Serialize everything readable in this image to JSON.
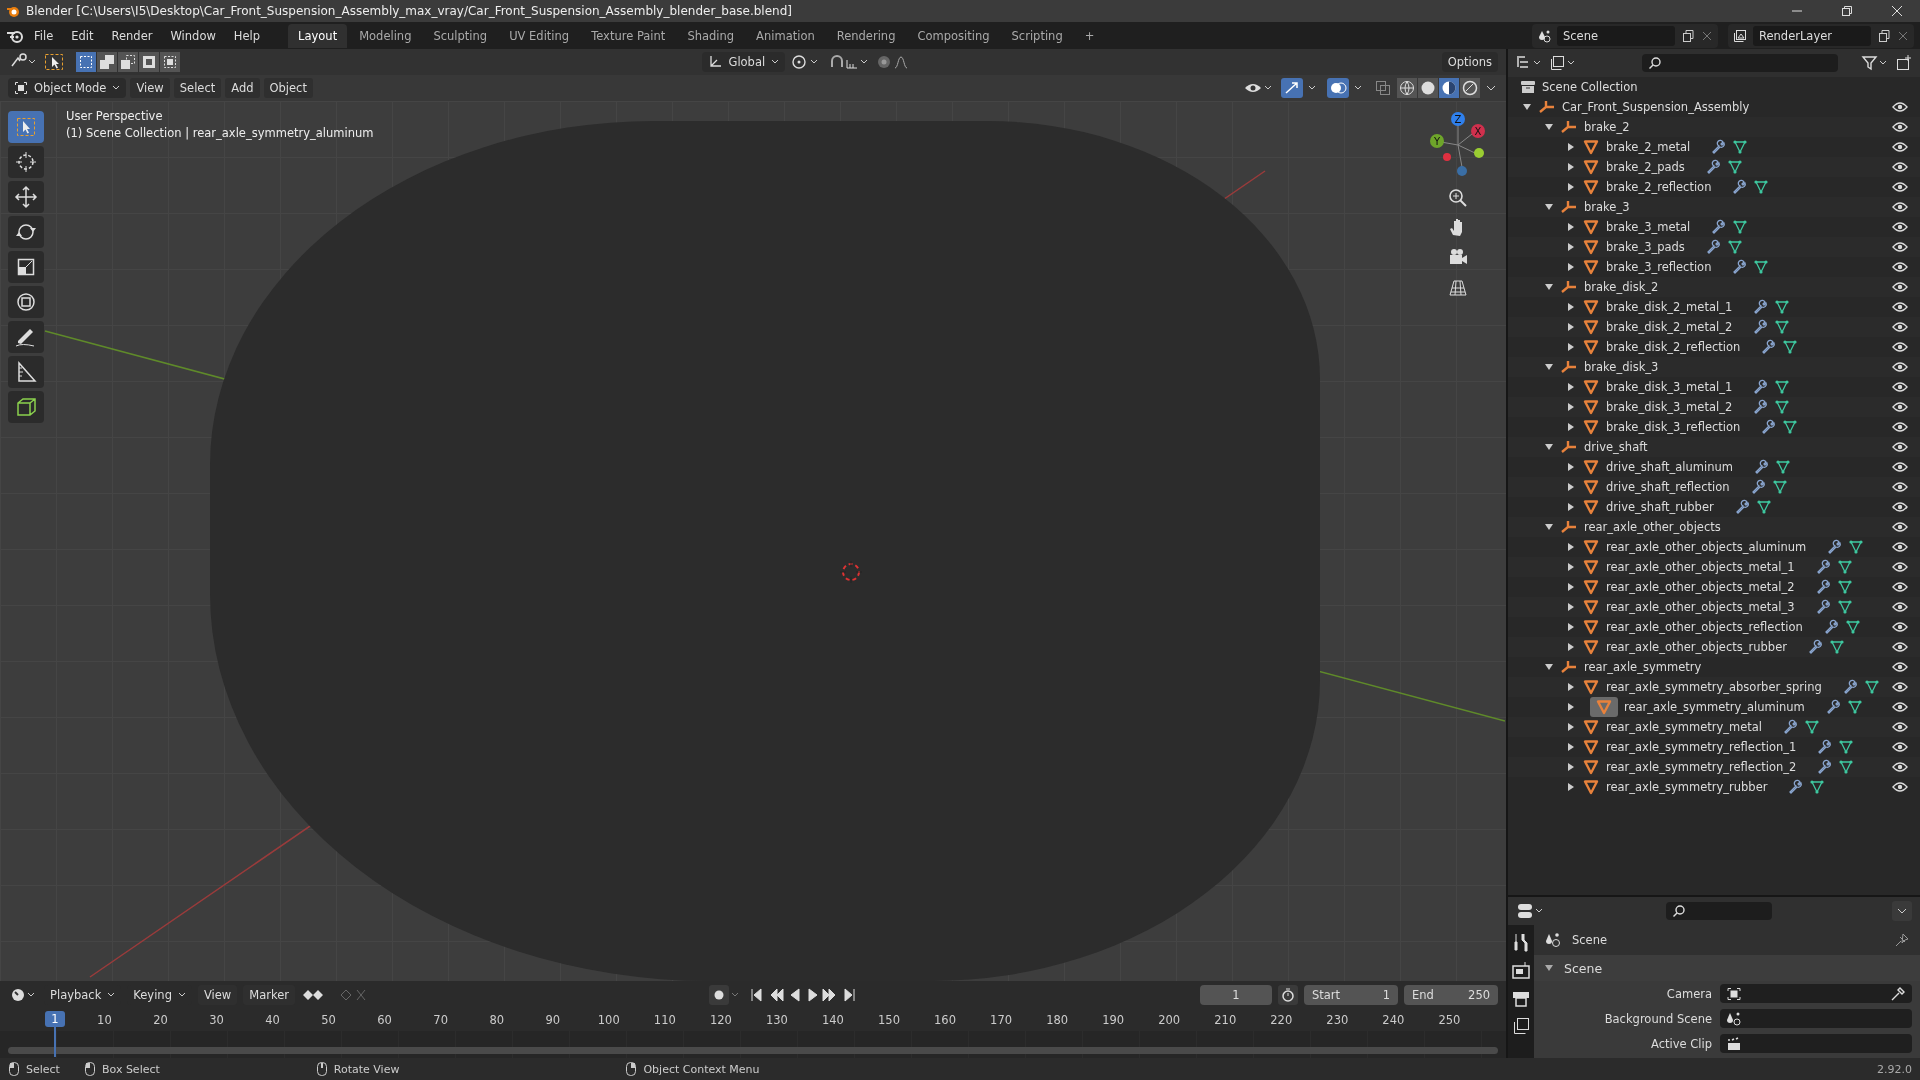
{
  "window": {
    "title": "Blender [C:\\Users\\I5\\Desktop\\Car_Front_Suspension_Assembly_max_vray/Car_Front_Suspension_Assembly_blender_base.blend]"
  },
  "menu": [
    "File",
    "Edit",
    "Render",
    "Window",
    "Help"
  ],
  "workspaces": [
    {
      "label": "Layout",
      "selected": true
    },
    {
      "label": "Modeling",
      "selected": false
    },
    {
      "label": "Sculpting",
      "selected": false
    },
    {
      "label": "UV Editing",
      "selected": false
    },
    {
      "label": "Texture Paint",
      "selected": false
    },
    {
      "label": "Shading",
      "selected": false
    },
    {
      "label": "Animation",
      "selected": false
    },
    {
      "label": "Rendering",
      "selected": false
    },
    {
      "label": "Compositing",
      "selected": false
    },
    {
      "label": "Scripting",
      "selected": false
    }
  ],
  "add_workspace": "+",
  "scene_field": "Scene",
  "view_layer_field": "RenderLayer",
  "viewport": {
    "orientation": "Global",
    "options": "Options",
    "mode": "Object Mode",
    "menus": [
      "View",
      "Select",
      "Add",
      "Object"
    ],
    "overlay_lines": [
      "User Perspective",
      "(1) Scene Collection | rear_axle_symmetry_aluminum"
    ],
    "shading_modes": [
      {
        "kind": "wireframe",
        "selected": false
      },
      {
        "kind": "solid",
        "selected": false
      },
      {
        "kind": "material",
        "selected": true
      },
      {
        "kind": "rendered",
        "selected": false
      }
    ],
    "gizmo_axes": [
      "Z",
      "Y",
      "X"
    ]
  },
  "outliner": {
    "root": "Scene Collection",
    "tree": [
      {
        "name": "Car_Front_Suspension_Assembly",
        "kind": "collection",
        "expanded": true,
        "selected": false,
        "children": [
          {
            "name": "brake_2",
            "kind": "collection",
            "expanded": true,
            "selected": false,
            "children": [
              {
                "name": "brake_2_metal",
                "kind": "mesh",
                "expanded": false,
                "selected": false
              },
              {
                "name": "brake_2_pads",
                "kind": "mesh",
                "expanded": false,
                "selected": false
              },
              {
                "name": "brake_2_reflection",
                "kind": "mesh",
                "expanded": false,
                "selected": false
              }
            ]
          },
          {
            "name": "brake_3",
            "kind": "collection",
            "expanded": true,
            "selected": false,
            "children": [
              {
                "name": "brake_3_metal",
                "kind": "mesh",
                "expanded": false,
                "selected": false
              },
              {
                "name": "brake_3_pads",
                "kind": "mesh",
                "expanded": false,
                "selected": false
              },
              {
                "name": "brake_3_reflection",
                "kind": "mesh",
                "expanded": false,
                "selected": false
              }
            ]
          },
          {
            "name": "brake_disk_2",
            "kind": "collection",
            "expanded": true,
            "selected": false,
            "children": [
              {
                "name": "brake_disk_2_metal_1",
                "kind": "mesh",
                "expanded": false,
                "selected": false
              },
              {
                "name": "brake_disk_2_metal_2",
                "kind": "mesh",
                "expanded": false,
                "selected": false
              },
              {
                "name": "brake_disk_2_reflection",
                "kind": "mesh",
                "expanded": false,
                "selected": false
              }
            ]
          },
          {
            "name": "brake_disk_3",
            "kind": "collection",
            "expanded": true,
            "selected": false,
            "children": [
              {
                "name": "brake_disk_3_metal_1",
                "kind": "mesh",
                "expanded": false,
                "selected": false
              },
              {
                "name": "brake_disk_3_metal_2",
                "kind": "mesh",
                "expanded": false,
                "selected": false
              },
              {
                "name": "brake_disk_3_reflection",
                "kind": "mesh",
                "expanded": false,
                "selected": false
              }
            ]
          },
          {
            "name": "drive_shaft",
            "kind": "collection",
            "expanded": true,
            "selected": false,
            "children": [
              {
                "name": "drive_shaft_aluminum",
                "kind": "mesh",
                "expanded": false,
                "selected": false
              },
              {
                "name": "drive_shaft_reflection",
                "kind": "mesh",
                "expanded": false,
                "selected": false
              },
              {
                "name": "drive_shaft_rubber",
                "kind": "mesh",
                "expanded": false,
                "selected": false
              }
            ]
          },
          {
            "name": "rear_axle_other_objects",
            "kind": "collection",
            "expanded": true,
            "selected": false,
            "children": [
              {
                "name": "rear_axle_other_objects_aluminum",
                "kind": "mesh",
                "expanded": false,
                "selected": false
              },
              {
                "name": "rear_axle_other_objects_metal_1",
                "kind": "mesh",
                "expanded": false,
                "selected": false
              },
              {
                "name": "rear_axle_other_objects_metal_2",
                "kind": "mesh",
                "expanded": false,
                "selected": false
              },
              {
                "name": "rear_axle_other_objects_metal_3",
                "kind": "mesh",
                "expanded": false,
                "selected": false
              },
              {
                "name": "rear_axle_other_objects_reflection",
                "kind": "mesh",
                "expanded": false,
                "selected": false
              },
              {
                "name": "rear_axle_other_objects_rubber",
                "kind": "mesh",
                "expanded": false,
                "selected": false
              }
            ]
          },
          {
            "name": "rear_axle_symmetry",
            "kind": "collection",
            "expanded": true,
            "selected": false,
            "children": [
              {
                "name": "rear_axle_symmetry_absorber_spring",
                "kind": "mesh",
                "expanded": false,
                "selected": false
              },
              {
                "name": "rear_axle_symmetry_aluminum",
                "kind": "mesh",
                "expanded": false,
                "selected": true
              },
              {
                "name": "rear_axle_symmetry_metal",
                "kind": "mesh",
                "expanded": false,
                "selected": false
              },
              {
                "name": "rear_axle_symmetry_reflection_1",
                "kind": "mesh",
                "expanded": false,
                "selected": false
              },
              {
                "name": "rear_axle_symmetry_reflection_2",
                "kind": "mesh",
                "expanded": false,
                "selected": false
              },
              {
                "name": "rear_axle_symmetry_rubber",
                "kind": "mesh",
                "expanded": false,
                "selected": false
              }
            ]
          }
        ]
      }
    ]
  },
  "properties": {
    "context": "Scene",
    "panel": {
      "title": "Scene",
      "expanded": true
    },
    "fields": [
      {
        "label": "Camera",
        "kind": "camera"
      },
      {
        "label": "Background Scene",
        "kind": "scene"
      },
      {
        "label": "Active Clip",
        "kind": "clip"
      }
    ]
  },
  "timeline": {
    "menus": [
      "Playback",
      "Keying",
      "View",
      "Marker"
    ],
    "current_frame": "1",
    "start_label": "Start",
    "start": "1",
    "end_label": "End",
    "end": "250",
    "playhead": "1",
    "ticks": [
      "10",
      "20",
      "30",
      "40",
      "50",
      "60",
      "70",
      "80",
      "90",
      "100",
      "110",
      "120",
      "130",
      "140",
      "150",
      "160",
      "170",
      "180",
      "190",
      "200",
      "210",
      "220",
      "230",
      "240",
      "250"
    ]
  },
  "status_bar": {
    "hints": [
      "Select",
      "Box Select",
      "Rotate View",
      "Object Context Menu"
    ],
    "version": "2.92.0"
  }
}
